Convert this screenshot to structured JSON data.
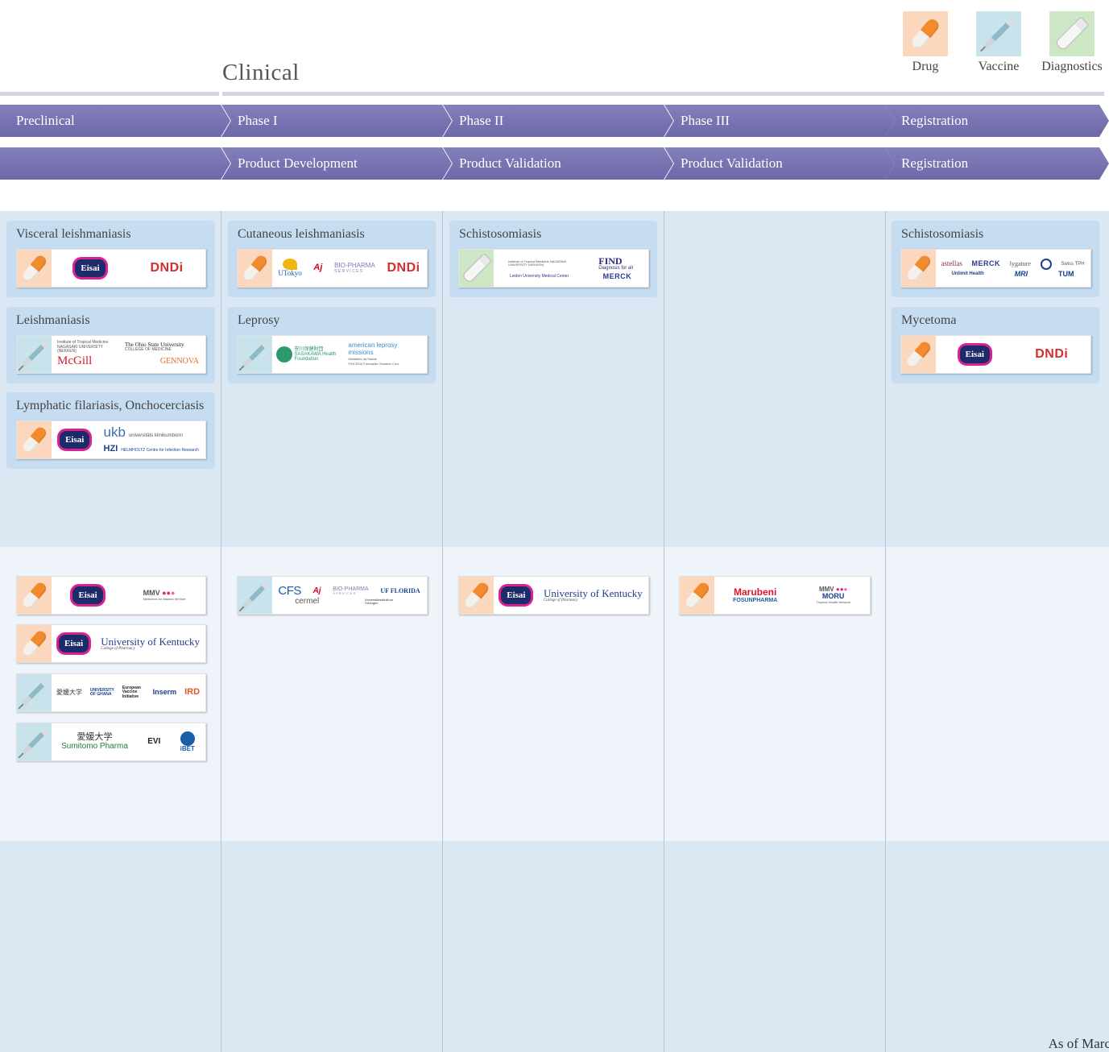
{
  "header": {
    "clinical": "Clinical",
    "legend": [
      {
        "label": "Drug",
        "icon": "drug-pill-icon"
      },
      {
        "label": "Vaccine",
        "icon": "vaccine-syringe-icon"
      },
      {
        "label": "Diagnostics",
        "icon": "diagnostics-tube-icon"
      }
    ]
  },
  "stages": {
    "row1": [
      "Preclinical",
      "Phase I",
      "Phase II",
      "Phase III",
      "Registration"
    ],
    "row2": [
      "",
      "Product Development",
      "Product Validation",
      "Product Validation",
      "Registration"
    ]
  },
  "colors": {
    "arrow": "#6d69aa",
    "band_dark": "#dbe7f3",
    "band_light": "#eef4fa",
    "group": "#c6ddf1",
    "drug": "#fbd7bd",
    "vaccine": "#c9e3ec",
    "diagnostics": "#cce6c6"
  },
  "groups": {
    "visceral": "Visceral leishmaniasis",
    "leish": "Leishmaniasis",
    "lf": "Lymphatic filariasis, Onchocerciasis",
    "cutaneous": "Cutaneous leishmaniasis",
    "leprosy": "Leprosy",
    "schisto_p2": "Schistosomiasis",
    "schisto_reg": "Schistosomiasis",
    "mycetoma": "Mycetoma"
  },
  "logos": {
    "eisai": "Eisai",
    "dndi": "DNDi",
    "utokyo": "UTokyo",
    "ajinomoto": "Aj",
    "biopharma": "BIO-PHARMA",
    "biopharma_sub": "S E R V I C E S",
    "nagasaki": "Institute of Tropical Medicine NAGASAKI UNIVERSITY (NEKKEN)",
    "ohio": "The Ohio State University",
    "ohio_sub": "COLLEGE OF MEDICINE",
    "mcgill": "McGill",
    "gennova": "GENNOVA",
    "ukb": "ukb",
    "ukb_sub": "universitäts klinikumbonn",
    "hzi": "HZI",
    "hzi_sub": "HELMHOLTZ Centre for Infection Research",
    "sasakawa": "笹川保健財団 SASAKAWA Health Foundation",
    "aml": "american leprosy missions",
    "ministerio": "Ministério da Saúde",
    "fiocruz": "FIOCRUZ Fundação Oswaldo Cruz",
    "nekken2": "Institute of Tropical Medicine NAGASAKI UNIVERSITY (NEKKEN)",
    "find": "FIND",
    "find_sub": "Diagnosis for all",
    "lumc": "Leiden University Medical Center",
    "merck": "MERCK",
    "astellas": "astellas",
    "lygature": "lygature",
    "swisstph": "Swiss TPH",
    "unlimit": "Unlimit Health",
    "mri": "MRI",
    "tum": "TUM",
    "mmv": "MMV",
    "mmv_sub": "Medicines for Malaria Venture",
    "uk": "University of Kentucky",
    "uk_sub": "College of Pharmacy",
    "ehime": "愛媛大学",
    "ghana": "UNIVERSITY OF GHANA",
    "inserm": "Inserm",
    "ird": "IRD",
    "evi": "European Vaccine Initiative",
    "sumitomo": "Sumitomo Pharma",
    "evi_short": "EVI",
    "ibet": "iBET",
    "cfs": "CFS",
    "uf": "UF FLORIDA",
    "cermel": "cermel",
    "tuebingen": "Universitätsklinikum Tübingen",
    "marubeni": "Marubeni",
    "fosun": "FOSUNPHARMA",
    "moru": "MORU",
    "moru_sub": "Tropical Health Network"
  },
  "footer": {
    "as_of": "As of Marc"
  }
}
